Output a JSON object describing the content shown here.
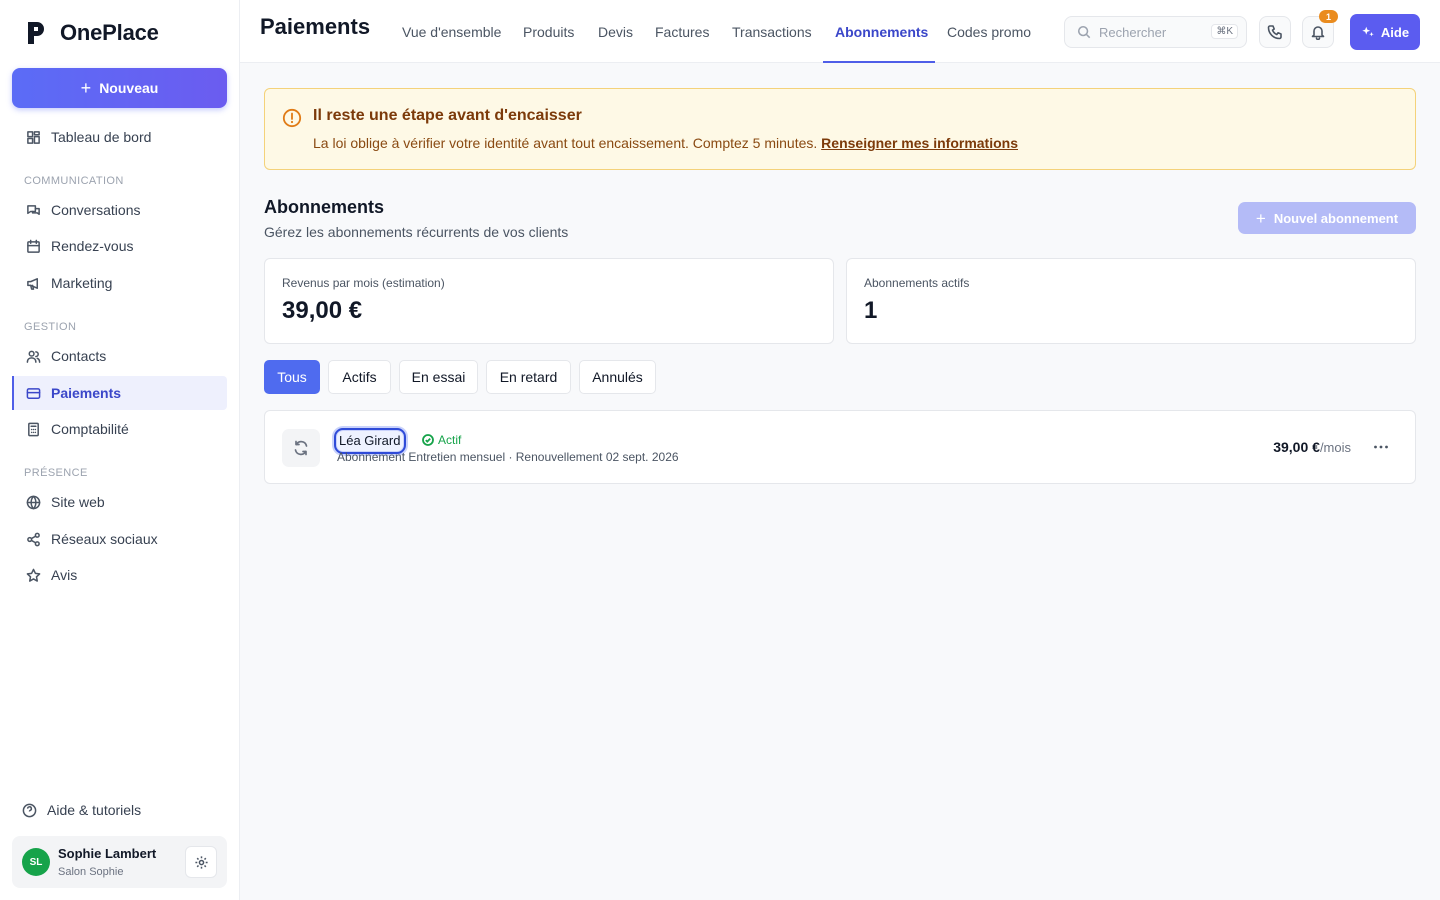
{
  "brand": {
    "name": "OnePlace"
  },
  "sidebar": {
    "new_label": "Nouveau",
    "dashboard": "Tableau de bord",
    "sections": [
      {
        "title": "COMMUNICATION",
        "items": [
          "Conversations",
          "Rendez-vous",
          "Marketing"
        ]
      },
      {
        "title": "GESTION",
        "items": [
          "Contacts",
          "Paiements",
          "Comptabilité"
        ]
      },
      {
        "title": "PRÉSENCE",
        "items": [
          "Site web",
          "Réseaux sociaux",
          "Avis"
        ]
      }
    ],
    "help": "Aide & tutoriels",
    "user": {
      "initials": "SL",
      "name": "Sophie Lambert",
      "org": "Salon Sophie"
    }
  },
  "header": {
    "title": "Paiements",
    "tabs": [
      "Vue d'ensemble",
      "Produits",
      "Devis",
      "Factures",
      "Transactions",
      "Abonnements",
      "Codes promo"
    ],
    "active_tab": "Abonnements",
    "search_placeholder": "Rechercher",
    "search_shortcut": "⌘K",
    "notification_count": "1",
    "help_button": "Aide"
  },
  "alert": {
    "title": "Il reste une étape avant d'encaisser",
    "text": "La loi oblige à vérifier votre identité avant tout encaissement. Comptez 5 minutes.",
    "link": "Renseigner mes informations"
  },
  "subscriptions": {
    "title": "Abonnements",
    "subtitle": "Gérez les abonnements récurrents de vos clients",
    "new_button": "Nouvel abonnement",
    "stats": [
      {
        "label": "Revenus par mois (estimation)",
        "value": "39,00 €"
      },
      {
        "label": "Abonnements actifs",
        "value": "1"
      }
    ],
    "filters": [
      "Tous",
      "Actifs",
      "En essai",
      "En retard",
      "Annulés"
    ],
    "active_filter": "Tous",
    "rows": [
      {
        "client": "Léa Girard",
        "status": "Actif",
        "description": "Abonnement Entretien mensuel · Renouvellement 02 sept. 2026",
        "amount": "39,00 €",
        "period": "/mois"
      }
    ]
  },
  "colors": {
    "accent": "#4f5ee8",
    "alert_bg": "#fef9e6",
    "alert_border": "#f4d27a",
    "status_active": "#16a34a",
    "badge": "#ea8c1f"
  }
}
